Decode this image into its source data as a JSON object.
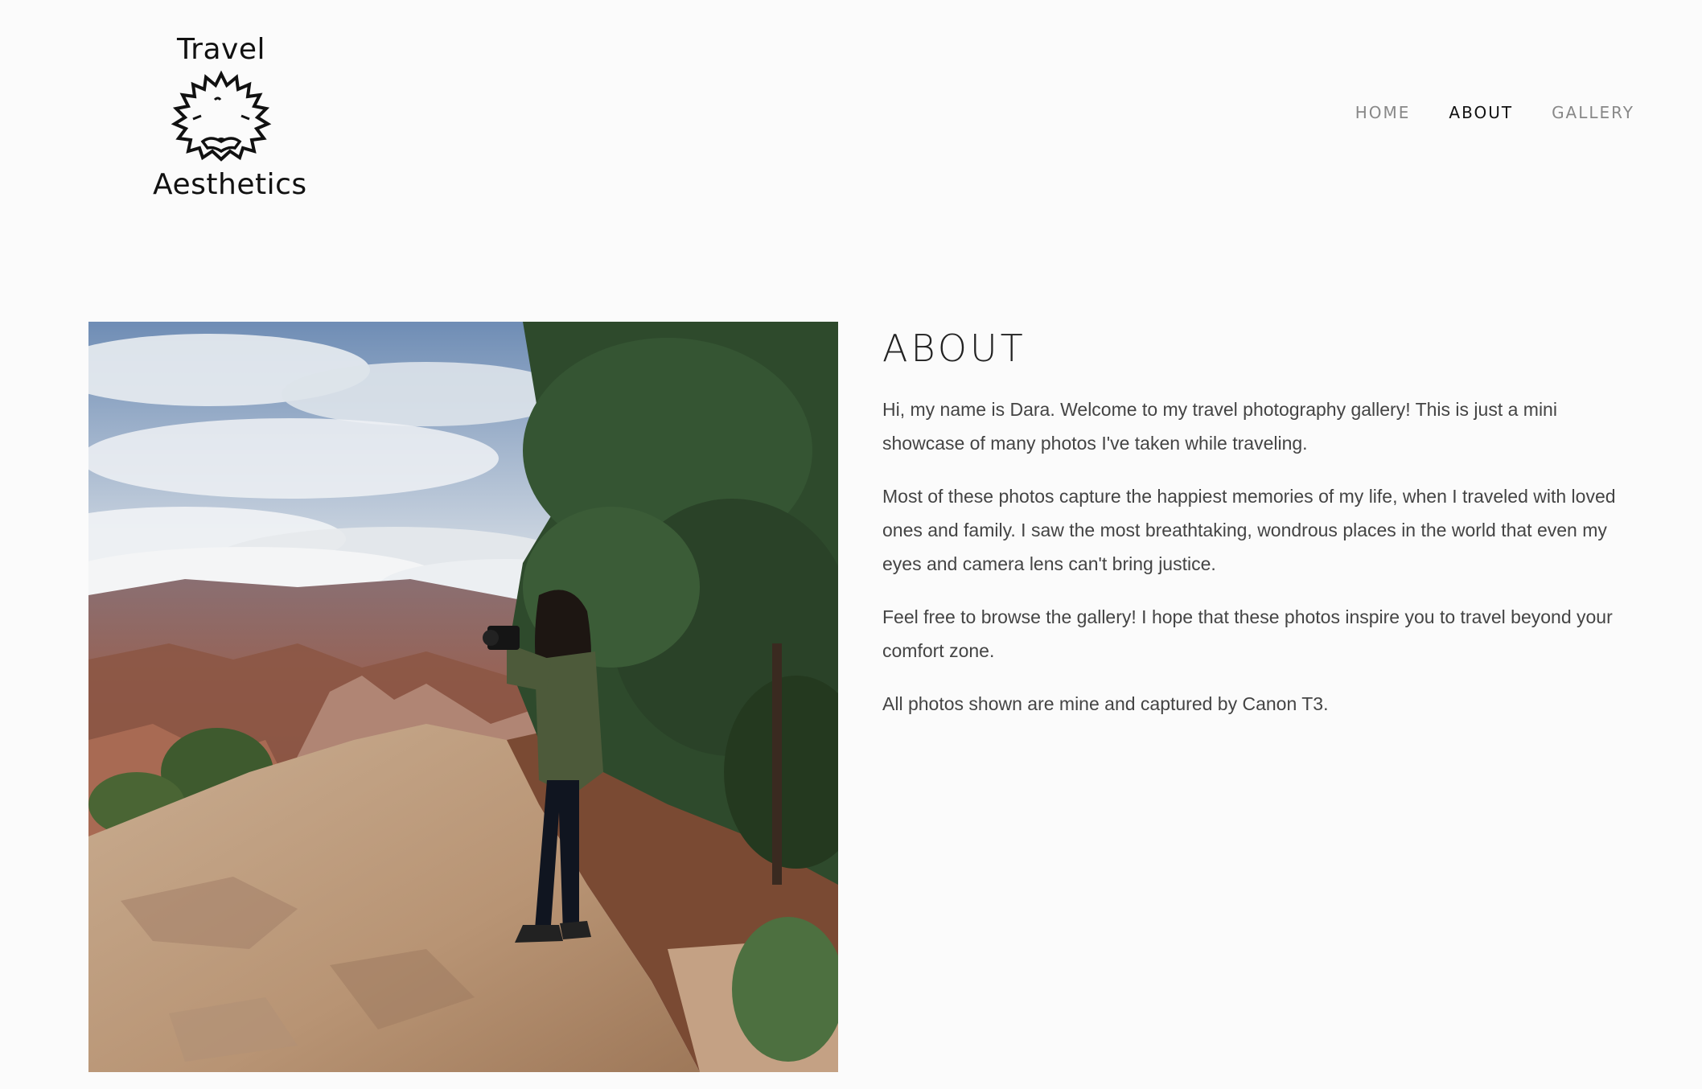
{
  "logo": {
    "line1": "Travel",
    "line2": "Aesthetics",
    "icon": "hedgehog-icon"
  },
  "nav": {
    "items": [
      {
        "label": "HOME",
        "active": false
      },
      {
        "label": "ABOUT",
        "active": true
      },
      {
        "label": "GALLERY",
        "active": false
      }
    ]
  },
  "about": {
    "heading": "ABOUT",
    "paragraphs": [
      "Hi, my name is Dara. Welcome to my travel photography gallery! This is just a mini showcase of many photos I've taken while traveling.",
      "Most of these photos capture the happiest memories of my life, when I traveled with loved ones and family. I saw the most breathtaking, wondrous places in the world that even my eyes and camera lens can't bring justice.",
      "Feel free to browse the gallery! I hope that these photos inspire you to travel beyond your comfort zone.",
      "All photos shown are mine and captured by Canon T3."
    ]
  },
  "colors": {
    "background": "#fbfbfb",
    "nav_inactive": "#888888",
    "nav_active": "#111111",
    "body_text": "#444444"
  }
}
